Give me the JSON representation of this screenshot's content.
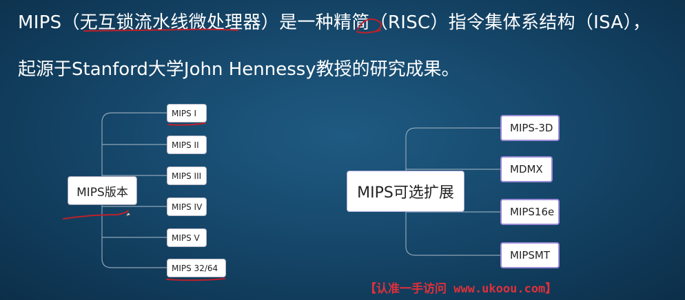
{
  "slide": {
    "line1": "MIPS（无互锁流水线微处理器）是一种精简（RISC）指令集体系结构（ISA），",
    "line2": "起源于Stanford大学John Hennessy教授的研究成果。"
  },
  "left_map": {
    "root": "MIPS版本",
    "children": [
      "MIPS I",
      "MIPS II",
      "MIPS III",
      "MIPS IV",
      "MIPS V",
      "MIPS 32/64"
    ]
  },
  "right_map": {
    "root": "MIPS可选扩展",
    "children": [
      "MIPS-3D",
      "MDMX",
      "MIPS16e",
      "MIPSMT"
    ]
  },
  "footer": "【认准一手访问 www.ukoou.com】",
  "colors": {
    "background": "#174a6e",
    "box_border_right": "#9a8ad6",
    "annotation_ink": "#c0202a",
    "footer": "#e0303a"
  }
}
